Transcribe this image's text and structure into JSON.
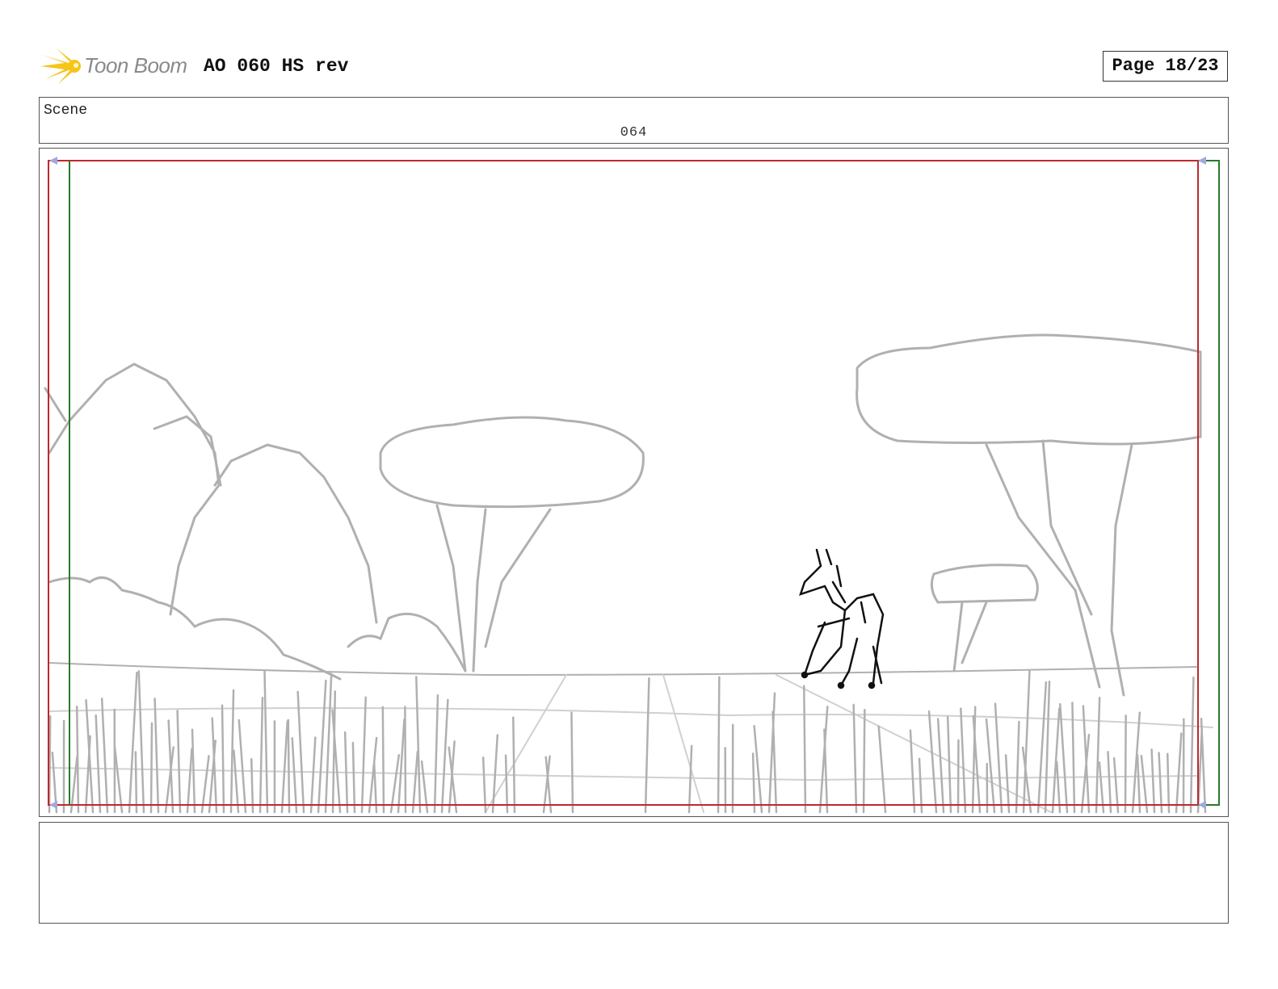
{
  "header": {
    "logo_text": "Toon Boom",
    "project_title": "AO 060 HS rev",
    "page_label": "Page 18/23"
  },
  "scene": {
    "label": "Scene",
    "number": "064"
  },
  "panel": {
    "frame_colors": {
      "action_safe": "#c0282d",
      "title_safe": "#2a7a2a",
      "sketch": "#b0b0b0",
      "character": "#111111"
    }
  },
  "notes": {}
}
